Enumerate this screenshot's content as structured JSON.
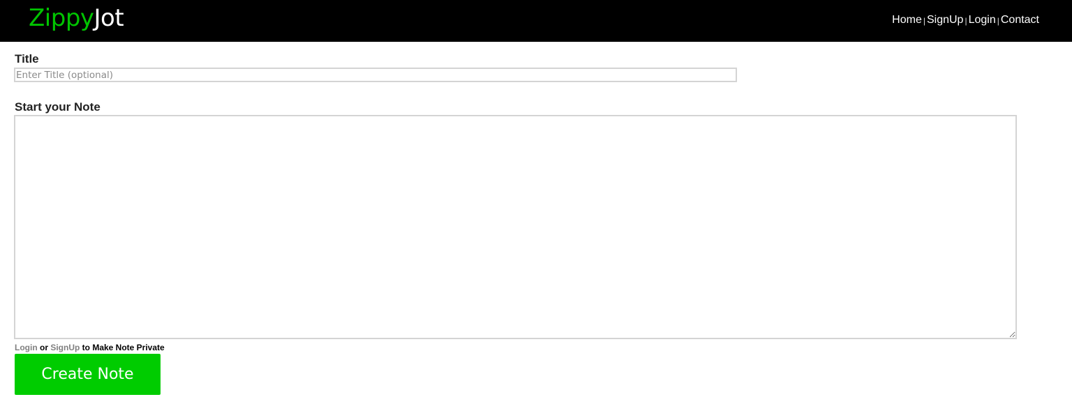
{
  "header": {
    "logo": {
      "part1": "Zippy",
      "part2": "Jot"
    },
    "nav": [
      {
        "label": "Home"
      },
      {
        "label": "SignUp"
      },
      {
        "label": "Login"
      },
      {
        "label": "Contact"
      }
    ],
    "separator": "|"
  },
  "form": {
    "title_label": "Title",
    "title_placeholder": "Enter Title (optional)",
    "title_value": "",
    "note_label": "Start your Note",
    "note_value": "",
    "private_hint": {
      "login_link": "Login",
      "or_text": " or ",
      "signup_link": "SignUp",
      "suffix": " to Make Note Private"
    },
    "submit_label": "Create Note"
  },
  "colors": {
    "header_bg": "#000000",
    "logo_green": "#00c400",
    "button_green": "#00cc00"
  }
}
